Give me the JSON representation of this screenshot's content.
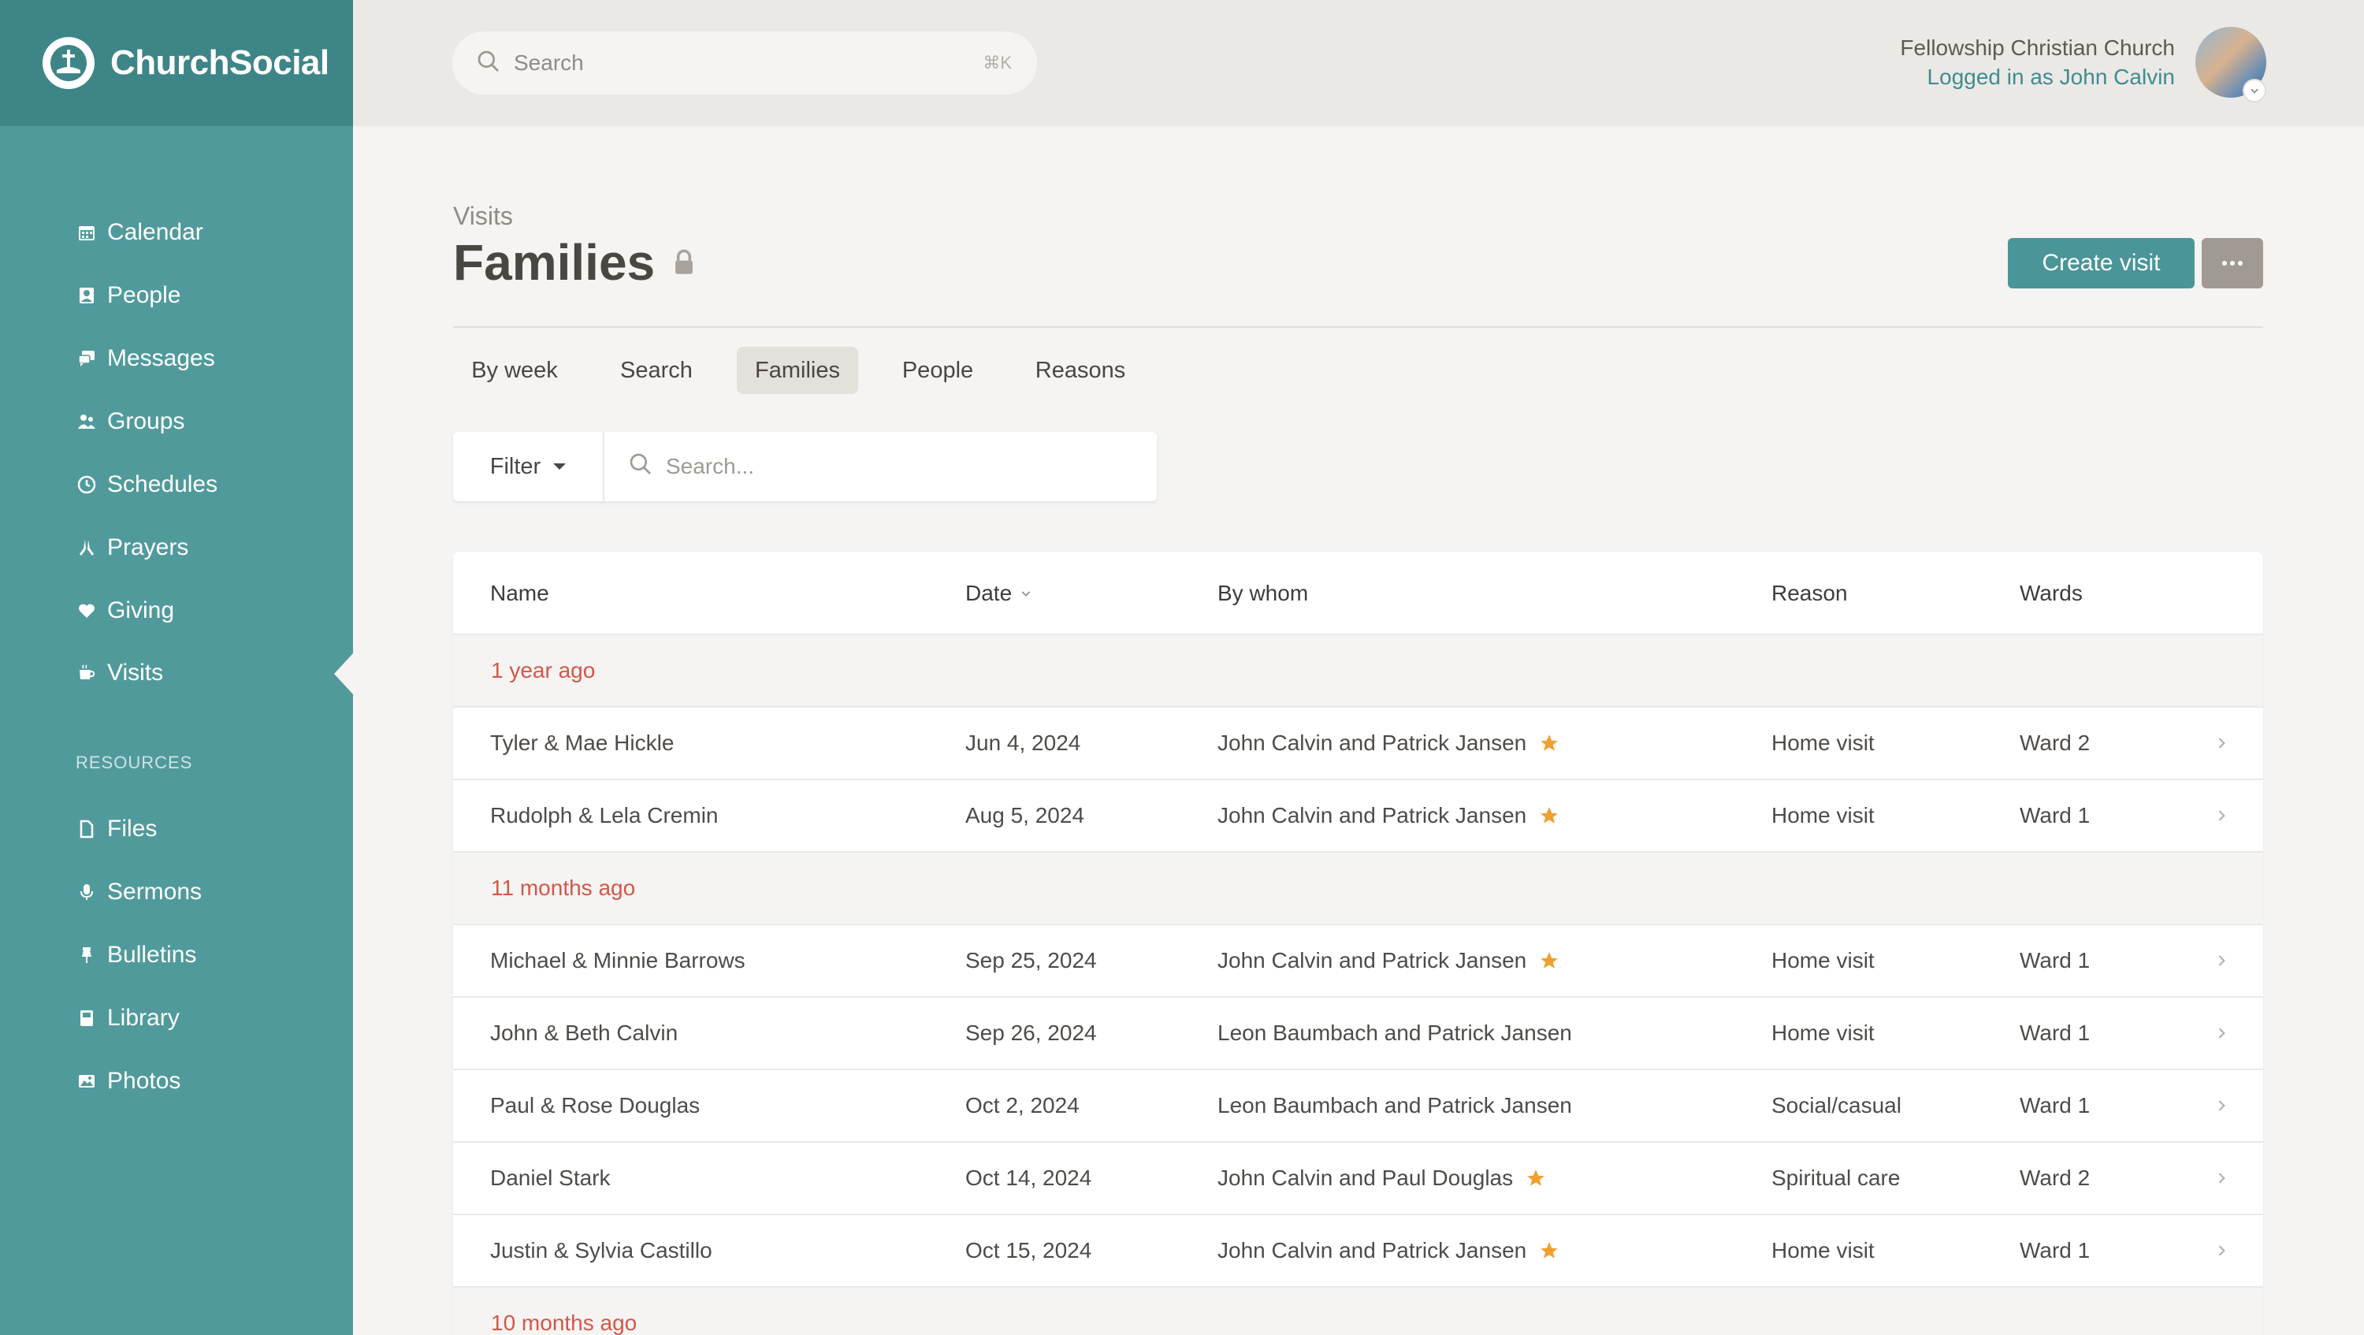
{
  "brand": {
    "name": "ChurchSocial"
  },
  "sidebar": {
    "items": [
      {
        "label": "Calendar",
        "icon": "calendar-icon"
      },
      {
        "label": "People",
        "icon": "person-card-icon"
      },
      {
        "label": "Messages",
        "icon": "chat-bubbles-icon"
      },
      {
        "label": "Groups",
        "icon": "group-icon"
      },
      {
        "label": "Schedules",
        "icon": "clock-icon"
      },
      {
        "label": "Prayers",
        "icon": "praying-hands-icon"
      },
      {
        "label": "Giving",
        "icon": "heart-icon"
      },
      {
        "label": "Visits",
        "icon": "coffee-cup-icon",
        "active": true
      }
    ],
    "resources_label": "RESOURCES",
    "resources": [
      {
        "label": "Files",
        "icon": "file-icon"
      },
      {
        "label": "Sermons",
        "icon": "microphone-icon"
      },
      {
        "label": "Bulletins",
        "icon": "pin-icon"
      },
      {
        "label": "Library",
        "icon": "book-icon"
      },
      {
        "label": "Photos",
        "icon": "image-icon"
      }
    ]
  },
  "topbar": {
    "search_placeholder": "Search",
    "search_shortcut": "⌘K",
    "org_name": "Fellowship Christian Church",
    "logged_in": "Logged in as John Calvin"
  },
  "page": {
    "breadcrumb": "Visits",
    "title": "Families",
    "create_label": "Create visit",
    "more_label": "···"
  },
  "tabs": [
    {
      "label": "By week"
    },
    {
      "label": "Search"
    },
    {
      "label": "Families",
      "active": true
    },
    {
      "label": "People"
    },
    {
      "label": "Reasons"
    }
  ],
  "filter": {
    "label": "Filter",
    "search_placeholder": "Search..."
  },
  "table": {
    "columns": {
      "name": "Name",
      "date": "Date",
      "by_whom": "By whom",
      "reason": "Reason",
      "wards": "Wards"
    },
    "groups": [
      {
        "label": "1 year ago"
      },
      {
        "label": "11 months ago"
      },
      {
        "label": "10 months ago"
      }
    ],
    "rows": [
      {
        "name": "Tyler & Mae Hickle",
        "date": "Jun 4, 2024",
        "by": "John Calvin and Patrick Jansen",
        "starred": true,
        "reason": "Home visit",
        "ward": "Ward 2"
      },
      {
        "name": "Rudolph & Lela Cremin",
        "date": "Aug 5, 2024",
        "by": "John Calvin and Patrick Jansen",
        "starred": true,
        "reason": "Home visit",
        "ward": "Ward 1"
      },
      {
        "name": "Michael & Minnie Barrows",
        "date": "Sep 25, 2024",
        "by": "John Calvin and Patrick Jansen",
        "starred": true,
        "reason": "Home visit",
        "ward": "Ward 1"
      },
      {
        "name": "John & Beth Calvin",
        "date": "Sep 26, 2024",
        "by": "Leon Baumbach and Patrick Jansen",
        "starred": false,
        "reason": "Home visit",
        "ward": "Ward 1"
      },
      {
        "name": "Paul & Rose Douglas",
        "date": "Oct 2, 2024",
        "by": "Leon Baumbach and Patrick Jansen",
        "starred": false,
        "reason": "Social/casual",
        "ward": "Ward 1"
      },
      {
        "name": "Daniel Stark",
        "date": "Oct 14, 2024",
        "by": "John Calvin and Paul Douglas",
        "starred": true,
        "reason": "Spiritual care",
        "ward": "Ward 2"
      },
      {
        "name": "Justin & Sylvia Castillo",
        "date": "Oct 15, 2024",
        "by": "John Calvin and Patrick Jansen",
        "starred": true,
        "reason": "Home visit",
        "ward": "Ward 1"
      }
    ]
  },
  "colors": {
    "sidebar": "#519a9c",
    "brand_bar": "#3e8588",
    "accent": "#4a9597",
    "group_label": "#d0584a",
    "star": "#f0a030"
  }
}
